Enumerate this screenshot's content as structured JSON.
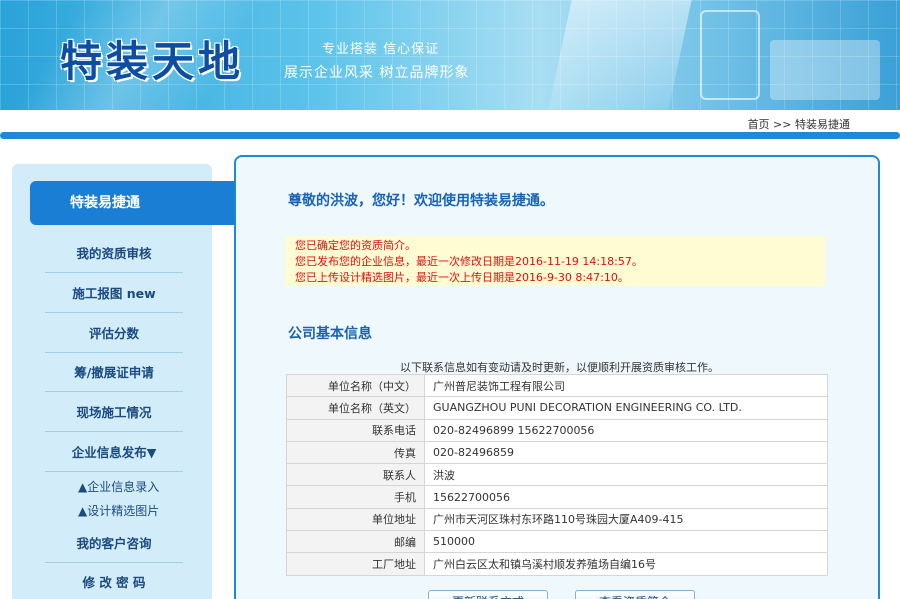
{
  "header": {
    "logo": "特装天地",
    "slogan1": "专业搭装  信心保证",
    "slogan2": "展示企业风采    树立品牌形象"
  },
  "breadcrumb": "首页 >> 特装易捷通",
  "sidebar": {
    "active": "特装易捷通",
    "items": [
      "我的资质审核",
      "施工报图 new",
      "评估分数",
      "筹/撤展证申请",
      "现场施工情况",
      "企业信息发布▼",
      "▲企业信息录入",
      "▲设计精选图片",
      "我的客户咨询",
      "修 改 密 码"
    ]
  },
  "main": {
    "welcome": "尊敬的洪波，您好！欢迎使用特装易捷通。",
    "notices": [
      "您已确定您的资质简介。",
      "您已发布您的企业信息，最近一次修改日期是2016-11-19 14:18:57。",
      "您已上传设计精选图片，最近一次上传日期是2016-9-30 8:47:10。"
    ],
    "section_title": "公司基本信息",
    "note": "以下联系信息如有变动请及时更新，以便顺利开展资质审核工作。",
    "rows": [
      {
        "k": "单位名称（中文）",
        "v": "广州普尼装饰工程有限公司"
      },
      {
        "k": "单位名称（英文）",
        "v": "GUANGZHOU PUNI DECORATION ENGINEERING CO. LTD."
      },
      {
        "k": "联系电话",
        "v": "020-82496899 15622700056"
      },
      {
        "k": "传真",
        "v": "020-82496859"
      },
      {
        "k": "联系人",
        "v": "洪波"
      },
      {
        "k": "手机",
        "v": "15622700056"
      },
      {
        "k": "单位地址",
        "v": "广州市天河区珠村东环路110号珠园大厦A409-415"
      },
      {
        "k": "邮编",
        "v": "510000"
      },
      {
        "k": "工厂地址",
        "v": "广州白云区太和镇乌溪村顺发养殖场自编16号"
      }
    ],
    "buttons": [
      "更新联系方式",
      "查看资质简介"
    ]
  }
}
